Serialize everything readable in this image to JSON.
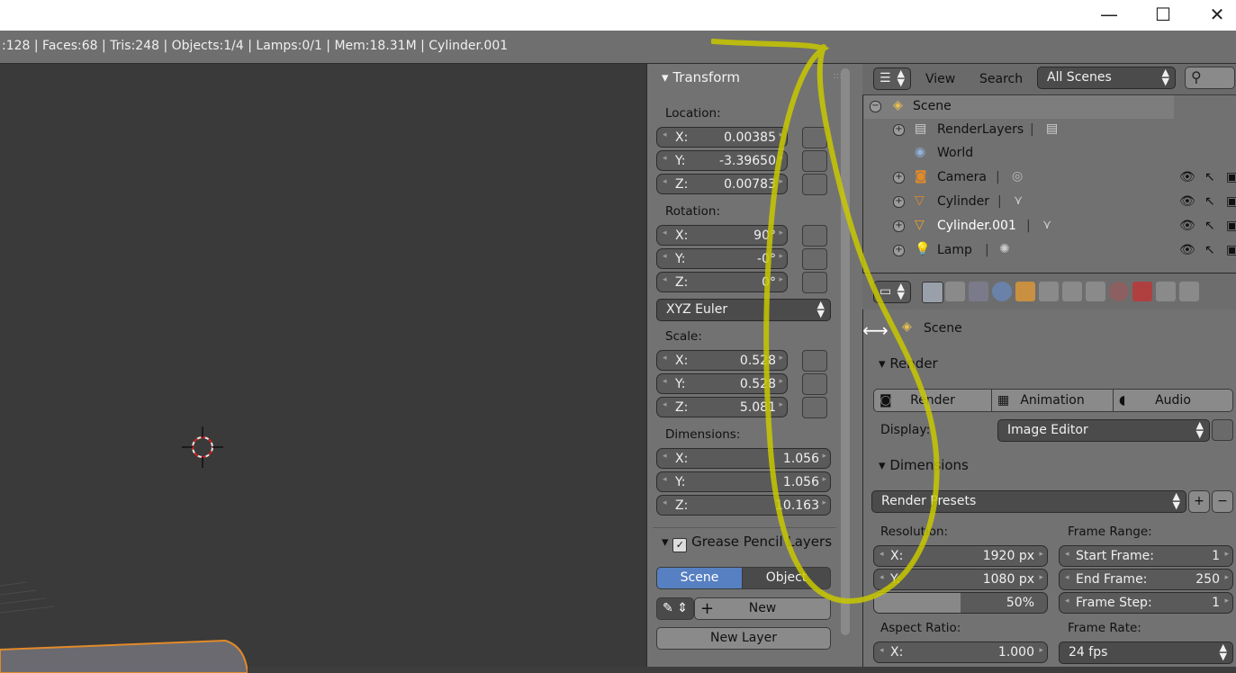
{
  "window": {
    "minimize_glyph": "—",
    "maximize_glyph": "☐",
    "close_glyph": "✕"
  },
  "infobar": {
    "stats": ":128 | Faces:68 | Tris:248 | Objects:1/4 | Lamps:0/1 | Mem:18.31M | Cylinder.001"
  },
  "transform": {
    "title": "Transform",
    "location_label": "Location:",
    "location": [
      {
        "axis": "X:",
        "value": "0.00385"
      },
      {
        "axis": "Y:",
        "value": "-3.39650"
      },
      {
        "axis": "Z:",
        "value": "0.00783"
      }
    ],
    "rotation_label": "Rotation:",
    "rotation": [
      {
        "axis": "X:",
        "value": "90°"
      },
      {
        "axis": "Y:",
        "value": "-0°"
      },
      {
        "axis": "Z:",
        "value": "0°"
      }
    ],
    "rotation_mode": "XYZ Euler",
    "scale_label": "Scale:",
    "scale": [
      {
        "axis": "X:",
        "value": "0.528"
      },
      {
        "axis": "Y:",
        "value": "0.528"
      },
      {
        "axis": "Z:",
        "value": "5.081"
      }
    ],
    "dimensions_label": "Dimensions:",
    "dimensions": [
      {
        "axis": "X:",
        "value": "1.056"
      },
      {
        "axis": "Y:",
        "value": "1.056"
      },
      {
        "axis": "Z:",
        "value": "10.163"
      }
    ]
  },
  "grease": {
    "title": "Grease Pencil Layers",
    "scene_tab": "Scene",
    "object_tab": "Object",
    "new_label": "New",
    "new_layer_label": "New Layer"
  },
  "outliner": {
    "view_menu": "View",
    "search_menu": "Search",
    "scenes_dropdown": "All Scenes",
    "rows": [
      {
        "label": "Scene"
      },
      {
        "label": "RenderLayers"
      },
      {
        "label": "World"
      },
      {
        "label": "Camera"
      },
      {
        "label": "Cylinder"
      },
      {
        "label": "Cylinder.001"
      },
      {
        "label": "Lamp"
      }
    ]
  },
  "properties": {
    "context_label": "Scene",
    "render_section": "Render",
    "render_btn": "Render",
    "animation_btn": "Animation",
    "audio_btn": "Audio",
    "display_label": "Display:",
    "display_value": "Image Editor",
    "dimensions_section": "Dimensions",
    "render_presets": "Render Presets",
    "resolution_label": "Resolution:",
    "res_x": {
      "axis": "X:",
      "value": "1920 px"
    },
    "res_y": {
      "axis": "Y:",
      "value": "1080 px"
    },
    "res_pct": "50%",
    "frame_range_label": "Frame Range:",
    "start_frame": {
      "label": "Start Frame:",
      "value": "1"
    },
    "end_frame": {
      "label": "End Frame:",
      "value": "250"
    },
    "frame_step": {
      "label": "Frame Step:",
      "value": "1"
    },
    "aspect_label": "Aspect Ratio:",
    "aspect_x": {
      "axis": "X:",
      "value": "1.000"
    },
    "frame_rate_label": "Frame Rate:",
    "frame_rate_value": "24 fps"
  },
  "colors": {
    "accent": "#5680c2",
    "annotation": "#c8c800",
    "selected_outline": "#e28a2a"
  }
}
